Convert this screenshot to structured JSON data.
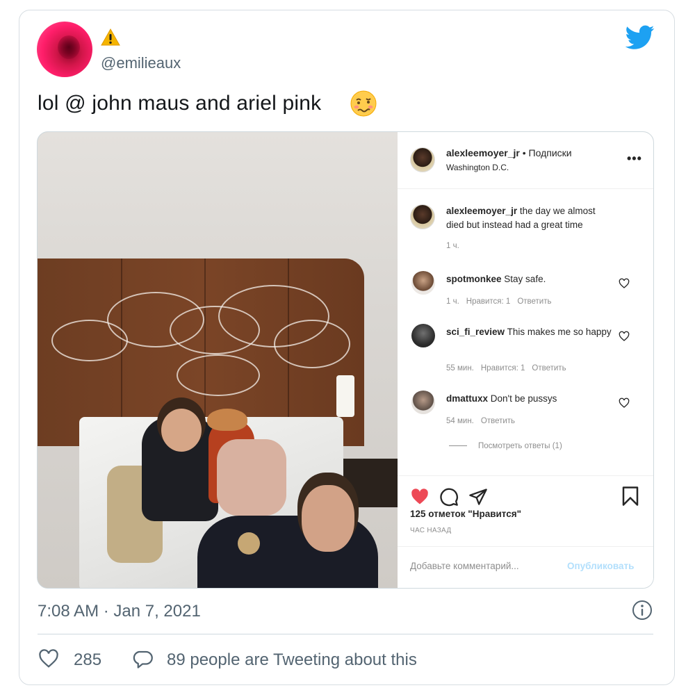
{
  "tweet": {
    "handle": "@emilieaux",
    "display_emoji": "warning-emoji",
    "text": "lol @ john maus and ariel pink",
    "text_emoji": "woozy-face-emoji",
    "timestamp": "7:08 AM · Jan 7, 2021",
    "like_count": "285",
    "reply_text": "89 people are Tweeting about this",
    "brand_color": "#1DA1F2"
  },
  "instagram": {
    "post_user": "alexleemoyer_jr",
    "follow_text": "• Подписки",
    "location": "Washington D.C.",
    "more_icon": "•••",
    "caption_user": "alexleemoyer_jr",
    "caption_text": "the day we almost died but instead had a great time",
    "caption_time": "1 ч.",
    "comments": [
      {
        "user": "spotmonkee",
        "text": "Stay safe.",
        "time": "1 ч.",
        "likes": "Нравится: 1",
        "reply": "Ответить"
      },
      {
        "user": "sci_fi_review",
        "text": "This makes me so happy",
        "time": "55 мин.",
        "likes": "Нравится: 1",
        "reply": "Ответить"
      },
      {
        "user": "dmattuxx",
        "text": "Don't be pussys",
        "time": "54 мин.",
        "likes": "",
        "reply": "Ответить"
      }
    ],
    "view_replies": "Посмотреть ответы (1)",
    "likes_text": "125 отметок \"Нравится\"",
    "post_time": "ЧАС НАЗАД",
    "comment_placeholder": "Добавьте комментарий...",
    "post_button": "Опубликовать",
    "like_color": "#ED4956"
  }
}
